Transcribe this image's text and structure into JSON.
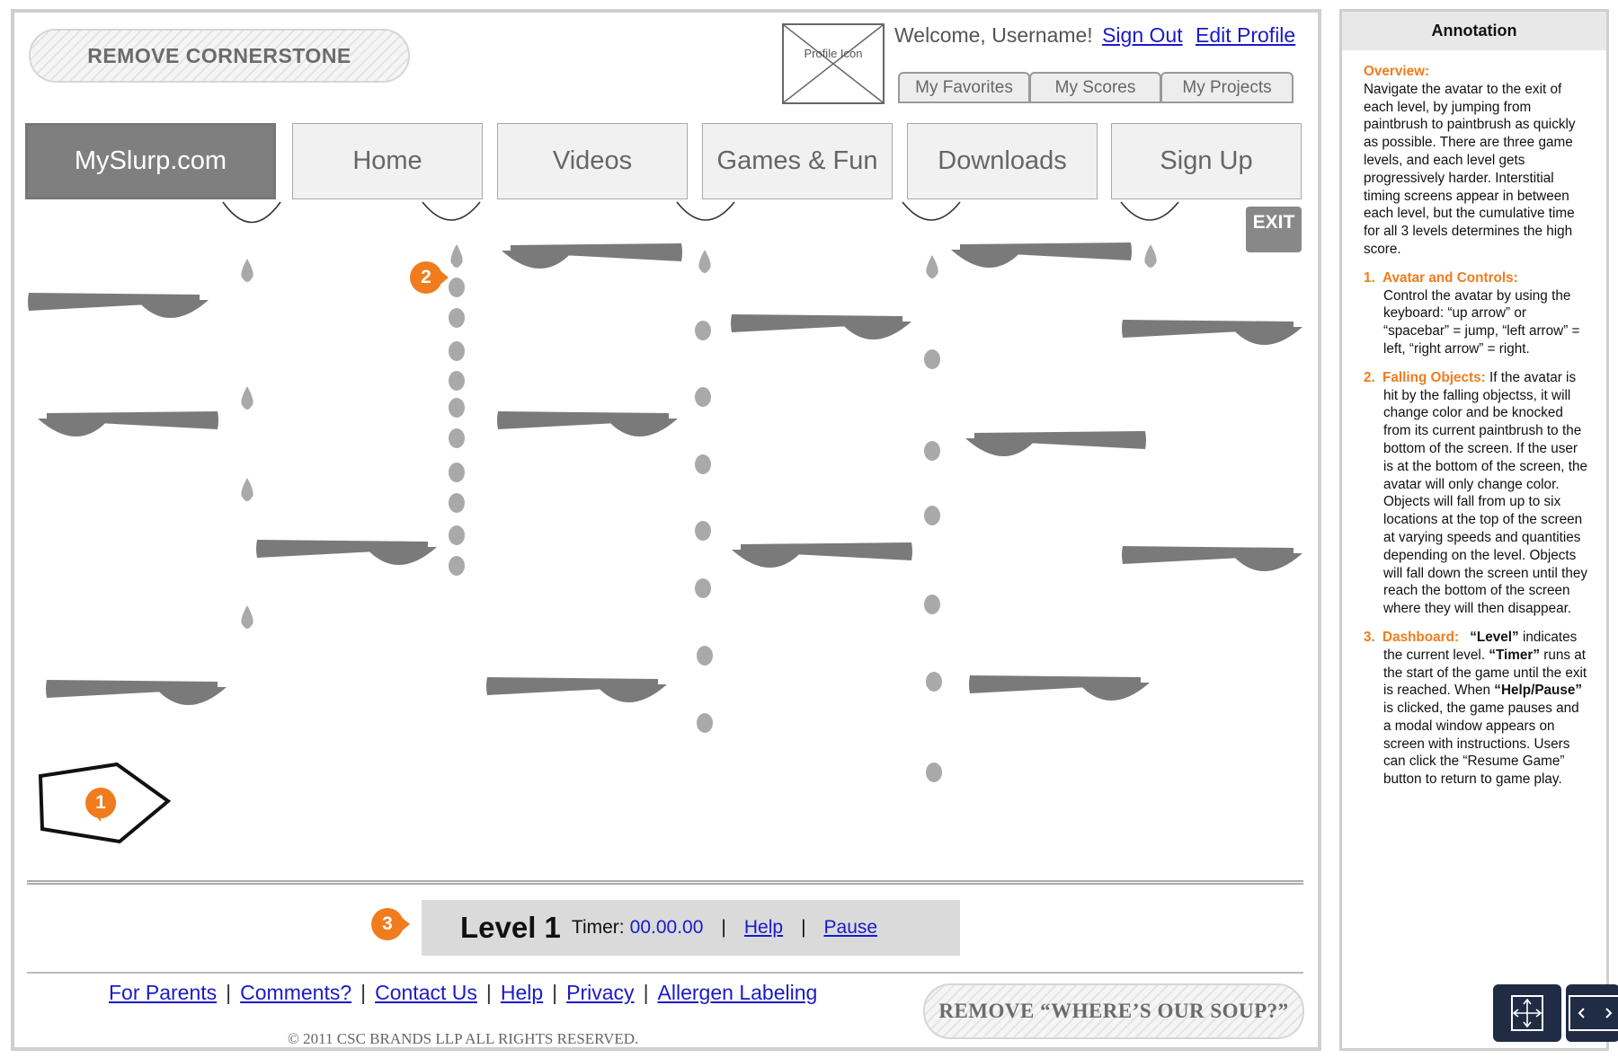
{
  "header": {
    "remove_cornerstone": "REMOVE CORNERSTONE",
    "profile_icon_label": "Profile Icon",
    "welcome_text": "Welcome, Username!",
    "sign_out": "Sign Out",
    "edit_profile": "Edit Profile",
    "user_tabs": [
      "My Favorites",
      "My Scores",
      "My Projects"
    ]
  },
  "nav": {
    "brand": "MySlurp.com",
    "items": [
      "Home",
      "Videos",
      "Games & Fun",
      "Downloads",
      "Sign Up"
    ]
  },
  "game": {
    "exit_label": "EXIT",
    "badges": [
      "1",
      "2",
      "3"
    ]
  },
  "dashboard": {
    "level_label": "Level 1",
    "timer_label": "Timer:",
    "timer_value": "00.00.00",
    "separator": "|",
    "help": "Help",
    "pause": "Pause"
  },
  "footer": {
    "links": [
      "For Parents",
      "Comments?",
      "Contact Us",
      "Help",
      "Privacy",
      "Allergen Labeling"
    ],
    "separator": "|",
    "remove_soup": "REMOVE “WHERE’S OUR SOUP?”",
    "copyright": "© 2011 CSC BRANDS LLP ALL RIGHTS RESERVED."
  },
  "annotation": {
    "title": "Annotation",
    "overview_title": "Overview:",
    "overview_text": "Navigate the avatar to the exit of each level, by jumping from paintbrush to paintbrush as quickly as possible. There are three game levels, and each level gets progressively harder. Interstitial timing screens appear in between each level, but the cumulative time for all 3 levels determines the high score.",
    "section1_num": "1.",
    "section1_title": "Avatar and Controls:",
    "section1_text": "Control the avatar by using the keyboard: “up arrow” or “spacebar” = jump, “left arrow” = left, “right arrow” = right.",
    "section2_num": "2.",
    "section2_title": "Falling Objects:",
    "section2_text": "If the avatar is hit by the falling objectss, it will change color and be knocked from its current paintbrush to the bottom of the screen. If the user is at the bottom of the screen, the avatar will only change color. Objects will fall from up to six locations at the top of the screen at varying speeds and quantities depending on the level. Objects will fall down the screen until they reach the bottom of the screen where they will then disappear.",
    "section3_num": "3.",
    "section3_title": "Dashboard:",
    "section3_level": "“Level”",
    "section3_text1": "indicates the current level.",
    "section3_timer": "“Timer”",
    "section3_text2": "runs at the start of the game until the exit is reached.",
    "section3_when": "When",
    "section3_helppause": "“Help/Pause”",
    "section3_text3": "is clicked, the game pauses and a modal window appears on screen with instructions. Users can click the “Resume Game” button to return to game play."
  },
  "colors": {
    "accent_orange": "#f07c1e",
    "link_blue": "#1a1ac8",
    "brush_gray": "#7a7a7a",
    "brand_gray": "#7f7f7f"
  }
}
